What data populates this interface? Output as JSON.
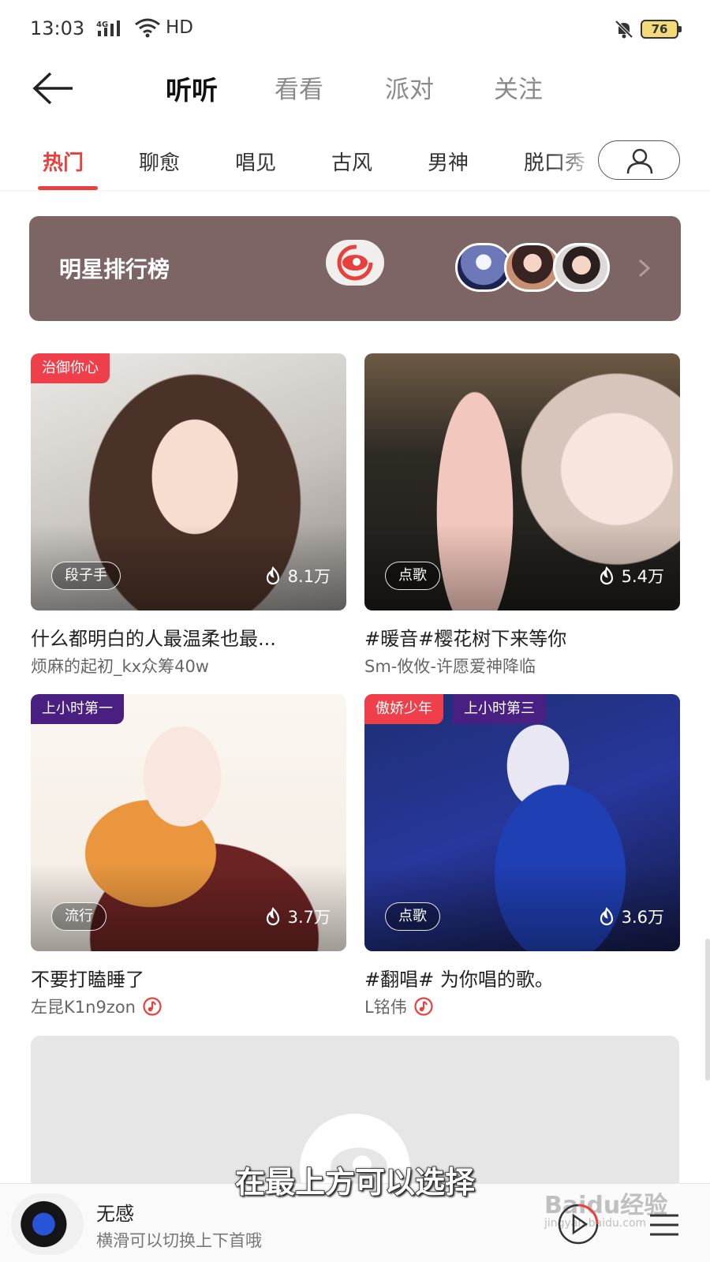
{
  "status": {
    "time": "13:03",
    "network": "4G",
    "hd_label": "HD",
    "battery": "76"
  },
  "top_nav": {
    "tabs": [
      {
        "label": "听听",
        "active": true
      },
      {
        "label": "看看",
        "active": false
      },
      {
        "label": "派对",
        "active": false
      },
      {
        "label": "关注",
        "active": false
      }
    ]
  },
  "sub_tabs": {
    "items": [
      {
        "label": "热门",
        "active": true
      },
      {
        "label": "聊愈",
        "active": false
      },
      {
        "label": "唱见",
        "active": false
      },
      {
        "label": "古风",
        "active": false
      },
      {
        "label": "男神",
        "active": false
      },
      {
        "label": "脱口秀",
        "active": false
      }
    ]
  },
  "banner": {
    "title": "明星排行榜",
    "background": "#7d6566"
  },
  "cards": [
    {
      "tags": [
        {
          "text": "治御你心",
          "color": "red"
        }
      ],
      "category": "段子手",
      "heat": "8.1万",
      "title": "什么都明白的人最温柔也最...",
      "subtitle": "烦麻的起初_kx众筹40w",
      "music_icon": false
    },
    {
      "tags": [],
      "category": "点歌",
      "heat": "5.4万",
      "title": "#暖音#樱花树下来等你",
      "subtitle": "Sm-攸攸-许愿爱神降临",
      "music_icon": false
    },
    {
      "tags": [
        {
          "text": "上小时第一",
          "color": "purple"
        }
      ],
      "category": "流行",
      "heat": "3.7万",
      "title": "不要打瞌睡了",
      "subtitle": "左昆K1n9zon",
      "music_icon": true
    },
    {
      "tags": [
        {
          "text": "傲娇少年",
          "color": "red"
        },
        {
          "text": "上小时第三",
          "color": "purple"
        }
      ],
      "category": "点歌",
      "heat": "3.6万",
      "title": "#翻唱# 为你唱的歌。",
      "subtitle": "L铭伟",
      "music_icon": true
    }
  ],
  "overlay_caption": "在最上方可以选择",
  "player": {
    "title": "无感",
    "hint": "横滑可以切换上下首哦"
  },
  "watermark": {
    "brand": "Baidu经验",
    "url": "jingyan.baidu.com"
  },
  "colors": {
    "accent": "#e8413d",
    "tag_red": "#ee3f4a",
    "tag_purple": "#4a1f82"
  }
}
